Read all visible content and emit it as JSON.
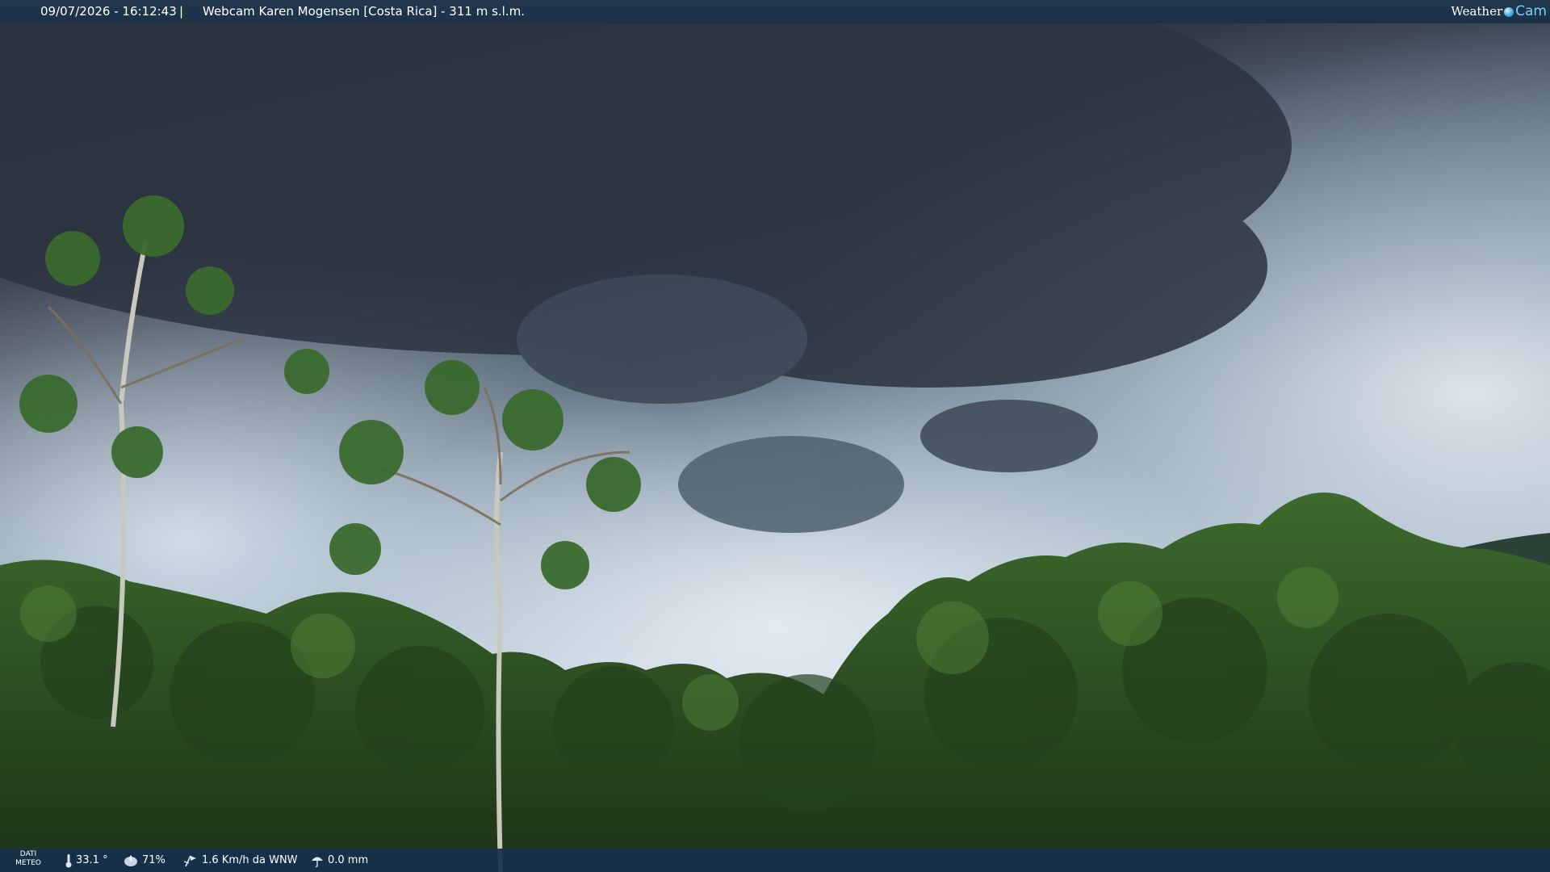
{
  "header": {
    "datetime": "09/07/2026 - 16:12:43",
    "separator": "|",
    "title": "Webcam Karen Mogensen [Costa Rica] - 311 m s.l.m.",
    "brand_word": "Weather",
    "brand_suffix": "Cam"
  },
  "footer": {
    "label_line1": "DATI",
    "label_line2": "METEO",
    "temperature": "33.1 °",
    "humidity": "71%",
    "wind": "1.6 Km/h da WNW",
    "rain": "0.0 mm",
    "icons": [
      "thermometer-icon",
      "humidity-icon",
      "wind-icon",
      "rain-icon"
    ]
  },
  "colors": {
    "bar": "#1c3046",
    "brand_accent": "#7cd0f5",
    "sky_dark": "#2a3440",
    "sky_light": "#c9d7e2",
    "foliage": "#2c4a22"
  }
}
